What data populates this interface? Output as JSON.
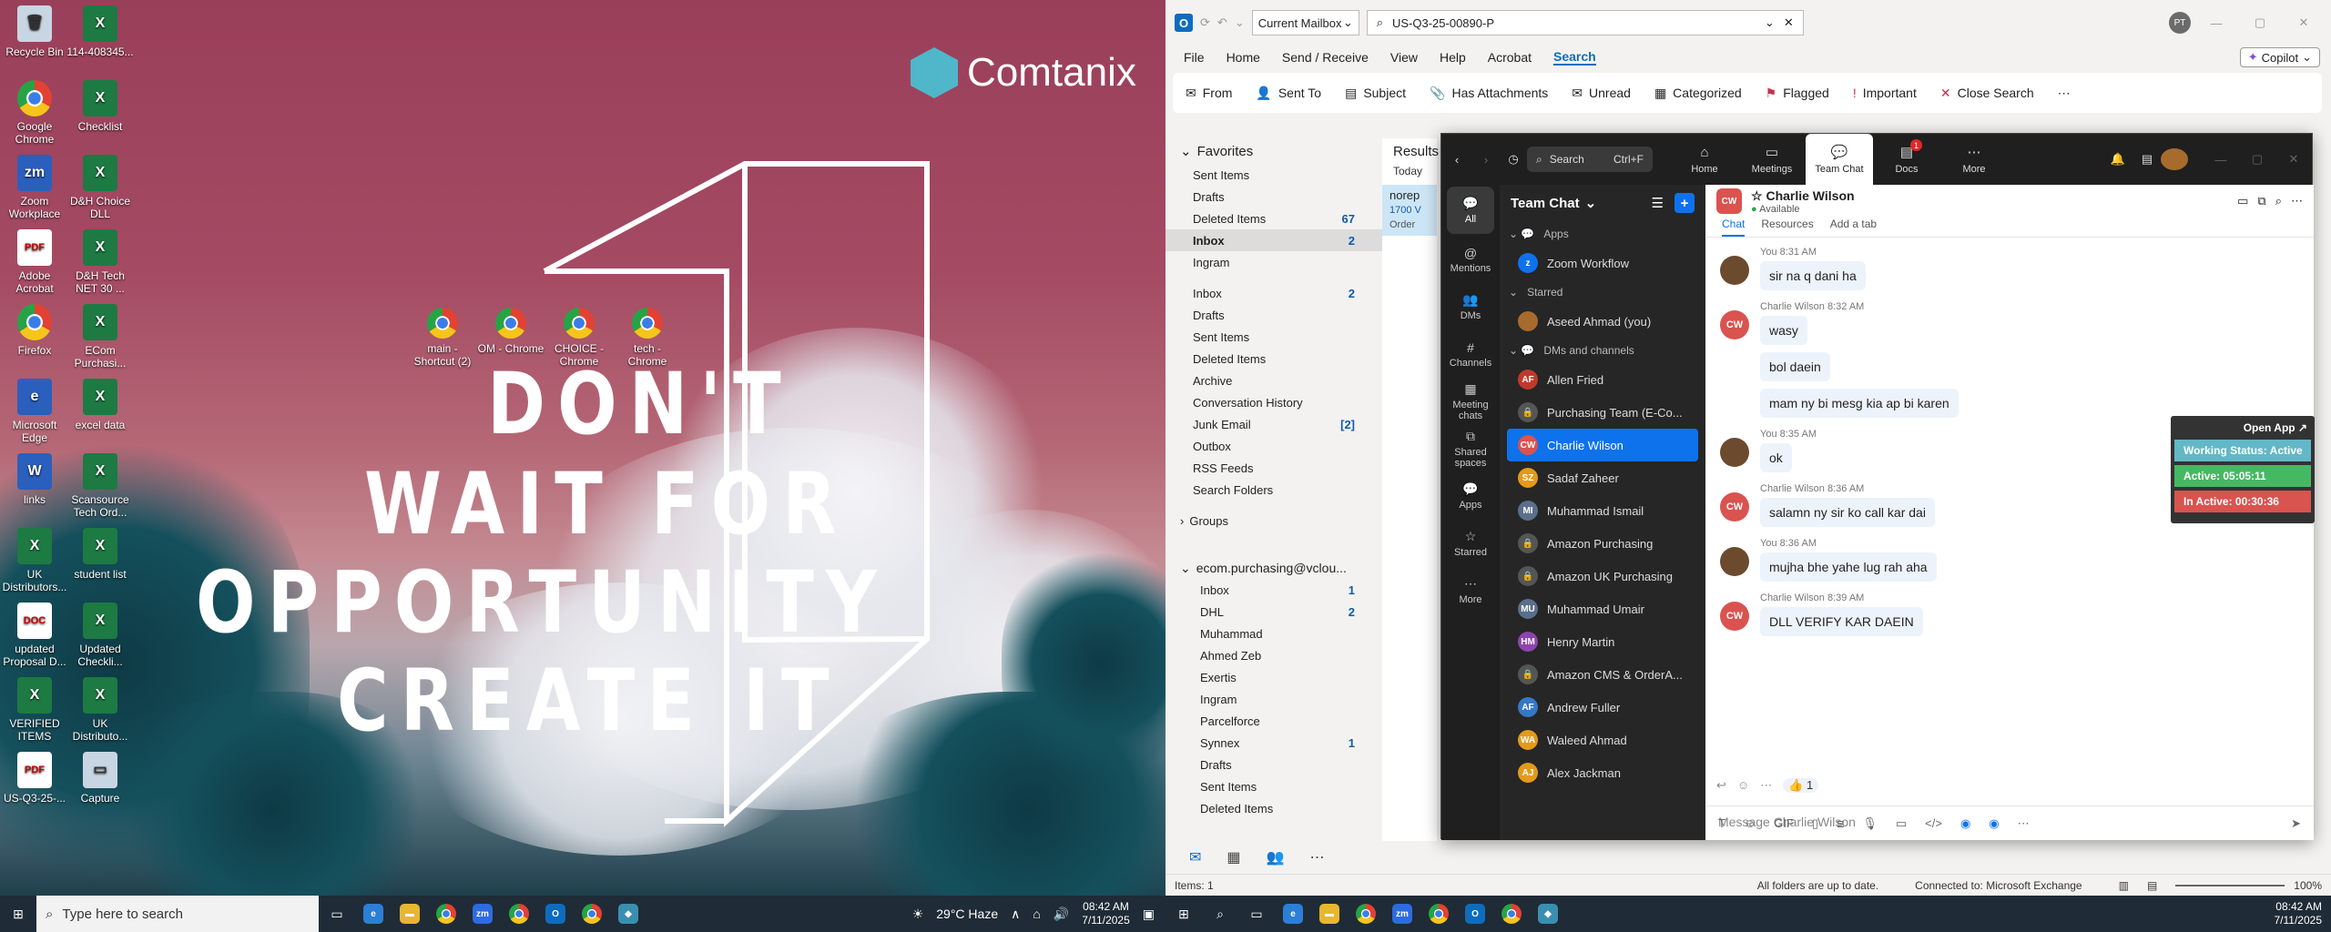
{
  "desktop": {
    "brand": "Comtanix",
    "quote": [
      "DON'T",
      "WAIT FOR",
      "OPPORTUNITY",
      "CREATE IT"
    ],
    "icons": [
      {
        "label": "Recycle Bin",
        "cls": "bin",
        "glyph": "🗑"
      },
      {
        "label": "114-408345...",
        "cls": "xl",
        "glyph": "X"
      },
      {
        "label": "Google Chrome",
        "cls": "chrome",
        "glyph": ""
      },
      {
        "label": "Checklist",
        "cls": "xl",
        "glyph": "X"
      },
      {
        "label": "Zoom Workplace",
        "cls": "word",
        "glyph": "zm"
      },
      {
        "label": "D&H Choice DLL",
        "cls": "xl",
        "glyph": "X"
      },
      {
        "label": "Adobe Acrobat",
        "cls": "pdf",
        "glyph": "PDF"
      },
      {
        "label": "D&H Tech NET 30 ...",
        "cls": "xl",
        "glyph": "X"
      },
      {
        "label": "Firefox",
        "cls": "chrome",
        "glyph": ""
      },
      {
        "label": "ECom Purchasi...",
        "cls": "xl",
        "glyph": "X"
      },
      {
        "label": "Microsoft Edge",
        "cls": "word",
        "glyph": "e"
      },
      {
        "label": "excel data",
        "cls": "xl",
        "glyph": "X"
      },
      {
        "label": "links",
        "cls": "word",
        "glyph": "W"
      },
      {
        "label": "Scansource Tech Ord...",
        "cls": "xl",
        "glyph": "X"
      },
      {
        "label": "UK Distributors...",
        "cls": "xl",
        "glyph": "X"
      },
      {
        "label": "student list",
        "cls": "xl",
        "glyph": "X"
      },
      {
        "label": "updated Proposal D...",
        "cls": "pdf",
        "glyph": "DOC"
      },
      {
        "label": "Updated Checkli...",
        "cls": "xl",
        "glyph": "X"
      },
      {
        "label": "VERIFIED ITEMS",
        "cls": "xl",
        "glyph": "X"
      },
      {
        "label": "UK Distributo...",
        "cls": "xl",
        "glyph": "X"
      },
      {
        "label": "US-Q3-25-...",
        "cls": "pdf",
        "glyph": "PDF"
      },
      {
        "label": "Capture",
        "cls": "bin",
        "glyph": "▭"
      }
    ],
    "shortcuts": [
      {
        "label": "main - Shortcut (2)"
      },
      {
        "label": "OM - Chrome"
      },
      {
        "label": "CHOICE - Chrome"
      },
      {
        "label": "tech - Chrome"
      }
    ]
  },
  "taskbar": {
    "search_placeholder": "Type here to search",
    "weather": "29°C  Haze",
    "time": "08:42 AM",
    "date": "7/11/2025"
  },
  "outlook": {
    "mailbox": "Current Mailbox",
    "search_query": "US-Q3-25-00890-P",
    "user": "PT",
    "copilot": "Copilot",
    "menu": [
      "File",
      "Home",
      "Send / Receive",
      "View",
      "Help",
      "Acrobat",
      "Search"
    ],
    "ribbon": [
      "From",
      "Sent To",
      "Subject",
      "Has Attachments",
      "Unread",
      "Categorized",
      "Flagged",
      "Important",
      "Close Search"
    ],
    "favorites_title": "Favorites",
    "favorites": [
      {
        "name": "Sent Items",
        "count": ""
      },
      {
        "name": "Drafts",
        "count": ""
      },
      {
        "name": "Deleted Items",
        "count": "67"
      },
      {
        "name": "Inbox",
        "count": "2"
      },
      {
        "name": "Ingram",
        "count": ""
      }
    ],
    "folders": [
      {
        "name": "Inbox",
        "count": "2"
      },
      {
        "name": "Drafts",
        "count": ""
      },
      {
        "name": "Sent Items",
        "count": ""
      },
      {
        "name": "Deleted Items",
        "count": ""
      },
      {
        "name": "Archive",
        "count": ""
      },
      {
        "name": "Conversation History",
        "count": ""
      },
      {
        "name": "Junk Email",
        "count": "[2]"
      },
      {
        "name": "Outbox",
        "count": ""
      },
      {
        "name": "RSS Feeds",
        "count": ""
      },
      {
        "name": "Search Folders",
        "count": ""
      }
    ],
    "groups": "Groups",
    "account": "ecom.purchasing@vclou...",
    "account_folders": [
      {
        "name": "Inbox",
        "count": "1"
      },
      {
        "name": "DHL",
        "count": "2"
      },
      {
        "name": "Muhammad",
        "count": ""
      },
      {
        "name": "Ahmed Zeb",
        "count": ""
      },
      {
        "name": "Exertis",
        "count": ""
      },
      {
        "name": "Ingram",
        "count": ""
      },
      {
        "name": "Parcelforce",
        "count": ""
      },
      {
        "name": "Synnex",
        "count": "1"
      },
      {
        "name": "Drafts",
        "count": ""
      },
      {
        "name": "Sent Items",
        "count": ""
      },
      {
        "name": "Deleted Items",
        "count": ""
      }
    ],
    "results_label": "Results",
    "today": "Today",
    "result_item": {
      "from": "norep",
      "line2": "1700 V",
      "line3": "Order"
    },
    "status": {
      "items": "Items: 1",
      "sync": "All folders are up to date.",
      "connected": "Connected to: Microsoft Exchange",
      "zoom": "100%"
    }
  },
  "zoom": {
    "search": "Search",
    "shortcut": "Ctrl+F",
    "tabs": [
      "Home",
      "Meetings",
      "Team Chat",
      "Docs",
      "More"
    ],
    "docs_badge": "1",
    "rail": [
      "All",
      "Mentions",
      "DMs",
      "Channels",
      "Meeting chats",
      "Shared spaces",
      "Apps",
      "Starred",
      "More"
    ],
    "list_title": "Team Chat",
    "sections": {
      "apps": "Apps",
      "starred": "Starred",
      "dms": "DMs and channels"
    },
    "app_item": "Zoom Workflow",
    "starred_item": "Aseed Ahmad (you)",
    "contacts": [
      {
        "name": "Allen Fried",
        "initials": "AF",
        "color": "#c0392b"
      },
      {
        "name": "Purchasing Team (E-Co...",
        "initials": "🔒",
        "color": "#555"
      },
      {
        "name": "Charlie Wilson",
        "initials": "CW",
        "color": "#d9534f"
      },
      {
        "name": "Sadaf Zaheer",
        "initials": "SZ",
        "color": "#e39a1b"
      },
      {
        "name": "Muhammad Ismail",
        "initials": "MI",
        "color": "#5a6f8a"
      },
      {
        "name": "Amazon Purchasing",
        "initials": "🔒",
        "color": "#555"
      },
      {
        "name": "Amazon UK Purchasing",
        "initials": "🔒",
        "color": "#555"
      },
      {
        "name": "Muhammad Umair",
        "initials": "MU",
        "color": "#5a6f8a"
      },
      {
        "name": "Henry Martin",
        "initials": "HM",
        "color": "#8e44ad"
      },
      {
        "name": "Amazon CMS & OrderA...",
        "initials": "🔒",
        "color": "#555"
      },
      {
        "name": "Andrew Fuller",
        "initials": "AF",
        "color": "#3478c6"
      },
      {
        "name": "Waleed Ahmad",
        "initials": "WA",
        "color": "#e39a1b"
      },
      {
        "name": "Alex Jackman",
        "initials": "AJ",
        "color": "#e39a1b"
      }
    ],
    "chat": {
      "name": "Charlie Wilson",
      "presence": "Available",
      "tabs": [
        "Chat",
        "Resources",
        "Add a tab"
      ],
      "messages": [
        {
          "meta": "You 8:31 AM",
          "texts": [
            "sir na q dani ha"
          ],
          "who": "you"
        },
        {
          "meta": "Charlie Wilson 8:32 AM",
          "texts": [
            "wasy",
            "bol daein",
            "mam ny bi mesg kia ap bi karen"
          ],
          "who": "cw"
        },
        {
          "meta": "You 8:35 AM",
          "texts": [
            "ok"
          ],
          "who": "you"
        },
        {
          "meta": "Charlie Wilson 8:36 AM",
          "texts": [
            "salamn ny sir ko call kar dai"
          ],
          "who": "cw"
        },
        {
          "meta": "You 8:36 AM",
          "texts": [
            "mujha bhe yahe lug rah aha"
          ],
          "who": "you"
        },
        {
          "meta": "Charlie Wilson 8:39 AM",
          "texts": [
            "DLL VERIFY KAR DAEIN"
          ],
          "who": "cw"
        }
      ],
      "reaction": "👍 1",
      "composer_placeholder": "Message Charlie Wilson"
    }
  },
  "status_widget": {
    "open": "Open App ↗",
    "working": "Working Status: Active",
    "active": "Active: 05:05:11",
    "inactive": "In Active: 00:30:36"
  }
}
